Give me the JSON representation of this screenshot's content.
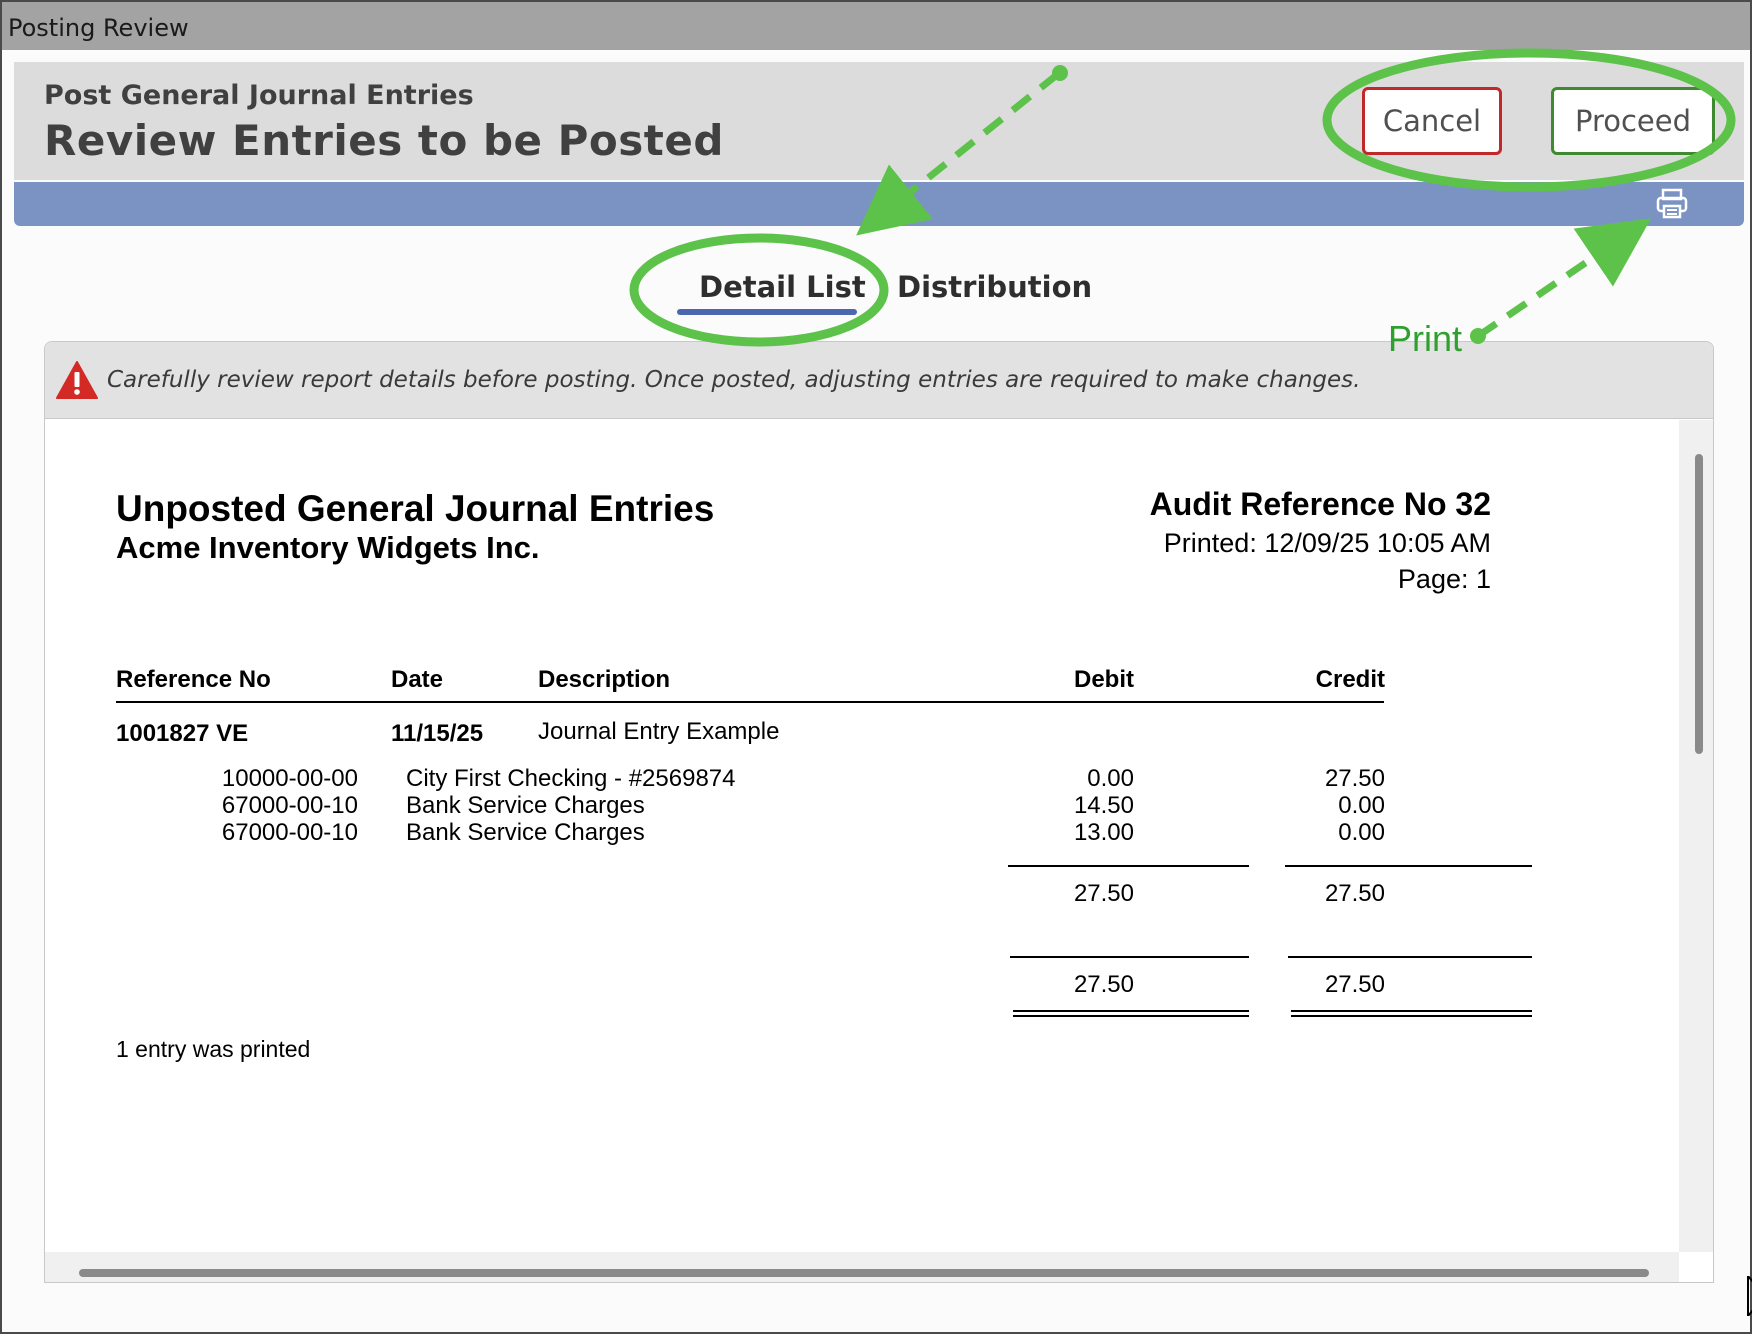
{
  "window": {
    "title": "Posting Review"
  },
  "header": {
    "subtitle": "Post General Journal Entries",
    "title": "Review Entries to be Posted",
    "cancel_label": "Cancel",
    "proceed_label": "Proceed"
  },
  "toolbar": {
    "print_icon": "printer-icon"
  },
  "tabs": [
    {
      "label": "Detail List",
      "active": true
    },
    {
      "label": "Distribution",
      "active": false
    }
  ],
  "warning": {
    "icon": "warning-triangle-icon",
    "text": "Carefully review report details before posting. Once posted, adjusting entries are required to make changes."
  },
  "report": {
    "title": "Unposted General Journal Entries",
    "company": "Acme Inventory Widgets Inc.",
    "audit_ref": "Audit Reference No 32",
    "printed": "Printed: 12/09/25 10:05 AM",
    "page": "Page: 1",
    "columns": {
      "reference": "Reference No",
      "date": "Date",
      "description": "Description",
      "debit": "Debit",
      "credit": "Credit"
    },
    "entry": {
      "reference": "1001827 VE",
      "date": "11/15/25",
      "description": "Journal Entry Example"
    },
    "lines": [
      {
        "account": "10000-00-00",
        "name": "City First Checking - #2569874",
        "debit": "0.00",
        "credit": "27.50"
      },
      {
        "account": "67000-00-10",
        "name": "Bank Service Charges",
        "debit": "14.50",
        "credit": "0.00"
      },
      {
        "account": "67000-00-10",
        "name": "Bank Service Charges",
        "debit": "13.00",
        "credit": "0.00"
      }
    ],
    "entry_total": {
      "debit": "27.50",
      "credit": "27.50"
    },
    "grand_total": {
      "debit": "27.50",
      "credit": "27.50"
    },
    "footer_note": "1 entry was printed"
  },
  "annotations": {
    "print_label": "Print",
    "color": "#5cc24a"
  },
  "colors": {
    "cancel_border": "#c0282a",
    "proceed_border": "#3f8a2e",
    "toolbar_band": "#7b93c3",
    "tab_underline": "#4a67b0"
  }
}
